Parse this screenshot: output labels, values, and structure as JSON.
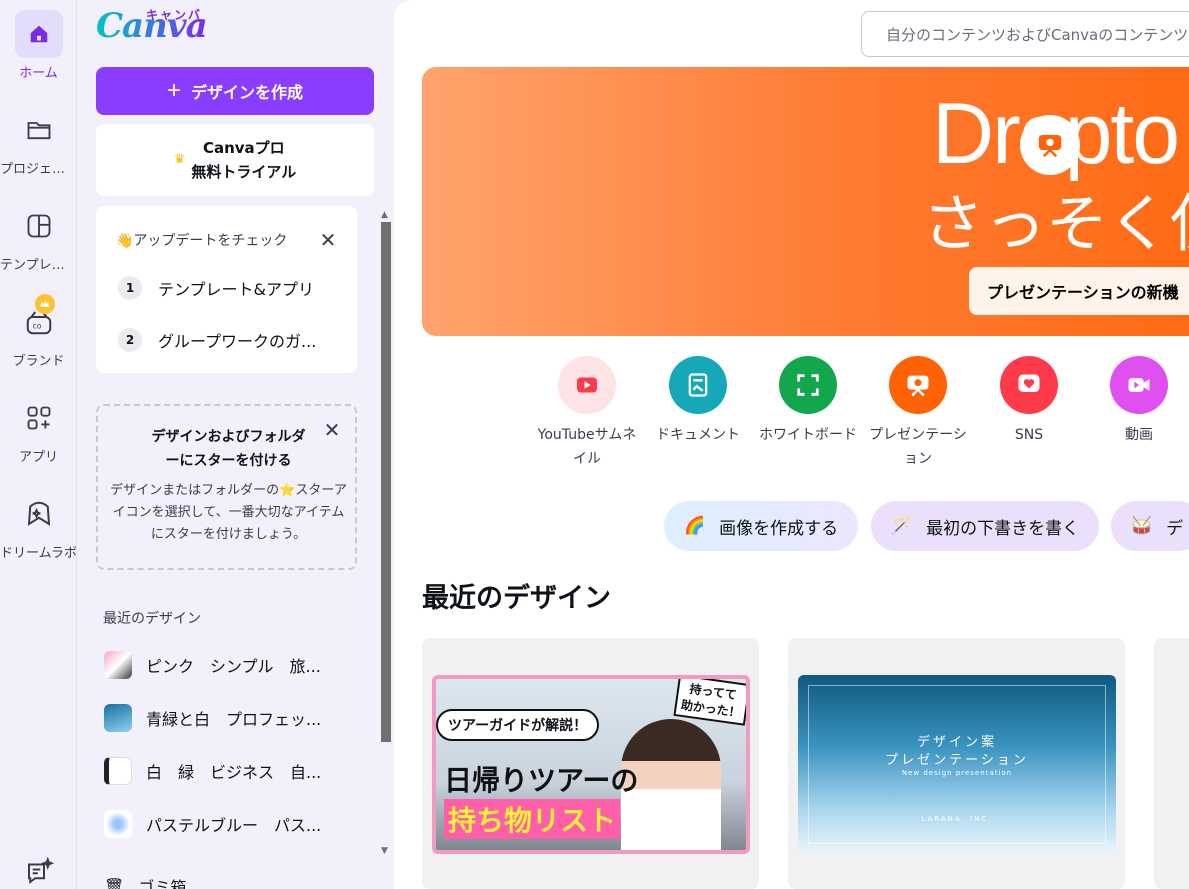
{
  "rail": {
    "items": [
      {
        "label": "ホーム",
        "icon": "home-icon"
      },
      {
        "label": "プロジェクト",
        "icon": "folder-icon"
      },
      {
        "label": "テンプレート",
        "icon": "template-icon"
      },
      {
        "label": "ブランド",
        "icon": "brand-icon"
      },
      {
        "label": "アプリ",
        "icon": "apps-icon"
      },
      {
        "label": "ドリームラボ",
        "icon": "dream-lab-icon"
      }
    ]
  },
  "panel": {
    "logo": "Canva",
    "logo_kana": "キャンバ",
    "create_label": "デザインを作成",
    "pro_line1": "Canvaプロ",
    "pro_line2": "無料トライアル",
    "update_title": "👋アップデートをチェック",
    "steps": [
      {
        "num": "1",
        "label": "テンプレート&アプリ"
      },
      {
        "num": "2",
        "label": "グループワークのガ..."
      }
    ],
    "star_title_1": "デザインおよびフォルダ",
    "star_title_2": "ーにスターを付ける",
    "star_desc": "デザインまたはフォルダーの⭐スターアイコンを選択して、一番大切なアイテムにスターを付けましょう。",
    "recent_head": "最近のデザイン",
    "recent": [
      {
        "label": "ピンク　シンプル　旅..."
      },
      {
        "label": "青緑と白　プロフェッ..."
      },
      {
        "label": "白　緑　ビジネス　自..."
      },
      {
        "label": "パステルブルー　パス..."
      }
    ],
    "trash": "ゴミ箱"
  },
  "main": {
    "search_placeholder": "自分のコンテンツおよびCanvaのコンテンツを検索",
    "hero_line1": "Dropto",
    "hero_line2": "さっそく使",
    "hero_button": "プレゼンテーションの新機",
    "categories": [
      {
        "label": "YouTubeサムネイル",
        "color": "#fde3e6",
        "icon": "youtube-icon"
      },
      {
        "label": "ドキュメント",
        "color": "#14a8b8",
        "icon": "document-icon"
      },
      {
        "label": "ホワイトボード",
        "color": "#13a74d",
        "icon": "whiteboard-icon"
      },
      {
        "label": "プレゼンテーション",
        "color": "#ff6105",
        "icon": "presentation-icon"
      },
      {
        "label": "SNS",
        "color": "#ff3b4b",
        "icon": "heart-icon"
      },
      {
        "label": "動画",
        "color": "#e04ff0",
        "icon": "video-icon"
      }
    ],
    "chips": [
      {
        "label": "画像を作成する",
        "emoji": "🌈"
      },
      {
        "label": "最初の下書きを書く",
        "emoji": "🪄"
      },
      {
        "label": "デ",
        "emoji": "🥁"
      }
    ],
    "recent_title": "最近のデザイン",
    "designs": [
      {
        "tag1": "ツアーガイドが解説！",
        "tag2": "持ってて\n助かった！",
        "title1": "日帰りツアーの",
        "title2": "持ち物リスト"
      },
      {
        "line1": "デザイン案",
        "line2": "プレゼンテーション",
        "line3": "New design presentation",
        "line4": "LARANA, INC."
      }
    ]
  }
}
